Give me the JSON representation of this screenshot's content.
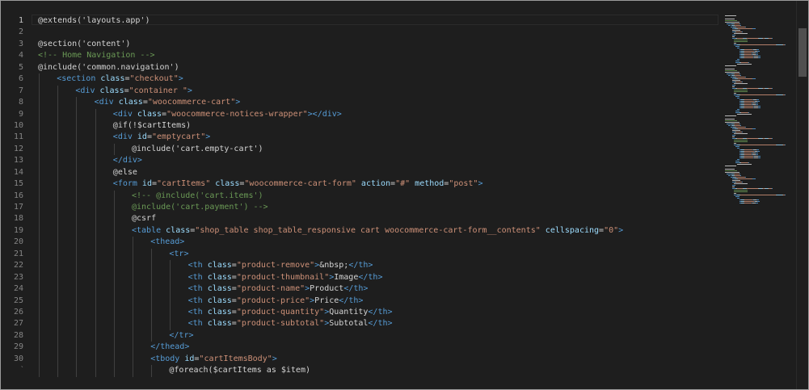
{
  "editor": {
    "active_line": "1",
    "line_numbers": [
      "1",
      "2",
      "3",
      "4",
      "5",
      "6",
      "7",
      "8",
      "9",
      "10",
      "11",
      "12",
      "13",
      "14",
      "15",
      "16",
      "17",
      "18",
      "19",
      "20",
      "21",
      "22",
      "23",
      "24",
      "25",
      "26",
      "27",
      "28",
      "29",
      "30",
      "ˋ"
    ],
    "colors": {
      "background": "#1e1e1e",
      "text": "#d4d4d4",
      "tag": "#569cd6",
      "attribute": "#9cdcfe",
      "string": "#ce9178",
      "comment": "#6a9955",
      "line_number": "#858585"
    },
    "lines": [
      {
        "indent": 0,
        "tokens": [
          {
            "t": "txt",
            "v": "@extends('layouts.app')"
          }
        ]
      },
      {
        "indent": 0,
        "tokens": []
      },
      {
        "indent": 0,
        "tokens": [
          {
            "t": "txt",
            "v": "@section('content')"
          }
        ]
      },
      {
        "indent": 0,
        "tokens": [
          {
            "t": "cmt",
            "v": "<!-- Home Navigation -->"
          }
        ]
      },
      {
        "indent": 0,
        "tokens": [
          {
            "t": "txt",
            "v": "@include('common.navigation')"
          }
        ]
      },
      {
        "indent": 1,
        "tokens": [
          {
            "t": "tag",
            "v": "<section "
          },
          {
            "t": "attr",
            "v": "class"
          },
          {
            "t": "txt",
            "v": "="
          },
          {
            "t": "str",
            "v": "\"checkout\""
          },
          {
            "t": "tag",
            "v": ">"
          }
        ]
      },
      {
        "indent": 2,
        "tokens": [
          {
            "t": "tag",
            "v": "<div "
          },
          {
            "t": "attr",
            "v": "class"
          },
          {
            "t": "txt",
            "v": "="
          },
          {
            "t": "str",
            "v": "\"container \""
          },
          {
            "t": "tag",
            "v": ">"
          }
        ]
      },
      {
        "indent": 3,
        "tokens": [
          {
            "t": "tag",
            "v": "<div "
          },
          {
            "t": "attr",
            "v": "class"
          },
          {
            "t": "txt",
            "v": "="
          },
          {
            "t": "str",
            "v": "\"woocommerce-cart\""
          },
          {
            "t": "tag",
            "v": ">"
          }
        ]
      },
      {
        "indent": 4,
        "tokens": [
          {
            "t": "tag",
            "v": "<div "
          },
          {
            "t": "attr",
            "v": "class"
          },
          {
            "t": "txt",
            "v": "="
          },
          {
            "t": "str",
            "v": "\"woocommerce-notices-wrapper\""
          },
          {
            "t": "tag",
            "v": "></div>"
          }
        ]
      },
      {
        "indent": 4,
        "tokens": [
          {
            "t": "txt",
            "v": "@if(!$cartItems)"
          }
        ]
      },
      {
        "indent": 4,
        "tokens": [
          {
            "t": "tag",
            "v": "<div "
          },
          {
            "t": "attr",
            "v": "id"
          },
          {
            "t": "txt",
            "v": "="
          },
          {
            "t": "str",
            "v": "\"emptycart\""
          },
          {
            "t": "tag",
            "v": ">"
          }
        ]
      },
      {
        "indent": 5,
        "tokens": [
          {
            "t": "txt",
            "v": "@include('cart.empty-cart')"
          }
        ]
      },
      {
        "indent": 4,
        "tokens": [
          {
            "t": "tag",
            "v": "</div>"
          }
        ]
      },
      {
        "indent": 4,
        "tokens": [
          {
            "t": "txt",
            "v": "@else"
          }
        ]
      },
      {
        "indent": 4,
        "tokens": [
          {
            "t": "tag",
            "v": "<form "
          },
          {
            "t": "attr",
            "v": "id"
          },
          {
            "t": "txt",
            "v": "="
          },
          {
            "t": "str",
            "v": "\"cartItems\""
          },
          {
            "t": "txt",
            "v": " "
          },
          {
            "t": "attr",
            "v": "class"
          },
          {
            "t": "txt",
            "v": "="
          },
          {
            "t": "str",
            "v": "\"woocommerce-cart-form\""
          },
          {
            "t": "txt",
            "v": " "
          },
          {
            "t": "attr",
            "v": "action"
          },
          {
            "t": "txt",
            "v": "="
          },
          {
            "t": "str",
            "v": "\"#\""
          },
          {
            "t": "txt",
            "v": " "
          },
          {
            "t": "attr",
            "v": "method"
          },
          {
            "t": "txt",
            "v": "="
          },
          {
            "t": "str",
            "v": "\"post\""
          },
          {
            "t": "tag",
            "v": ">"
          }
        ]
      },
      {
        "indent": 5,
        "tokens": [
          {
            "t": "cmt",
            "v": "<!-- @include('cart.items')"
          }
        ]
      },
      {
        "indent": 5,
        "tokens": [
          {
            "t": "cmt",
            "v": "@include('cart.payment') -->"
          }
        ]
      },
      {
        "indent": 5,
        "tokens": [
          {
            "t": "txt",
            "v": "@csrf"
          }
        ]
      },
      {
        "indent": 5,
        "tokens": [
          {
            "t": "tag",
            "v": "<table "
          },
          {
            "t": "attr",
            "v": "class"
          },
          {
            "t": "txt",
            "v": "="
          },
          {
            "t": "str",
            "v": "\"shop_table shop_table_responsive cart woocommerce-cart-form__contents\""
          },
          {
            "t": "txt",
            "v": " "
          },
          {
            "t": "attr",
            "v": "cellspacing"
          },
          {
            "t": "txt",
            "v": "="
          },
          {
            "t": "str",
            "v": "\"0\""
          },
          {
            "t": "tag",
            "v": ">"
          }
        ]
      },
      {
        "indent": 6,
        "tokens": [
          {
            "t": "tag",
            "v": "<thead>"
          }
        ]
      },
      {
        "indent": 7,
        "tokens": [
          {
            "t": "tag",
            "v": "<tr>"
          }
        ]
      },
      {
        "indent": 8,
        "tokens": [
          {
            "t": "tag",
            "v": "<th "
          },
          {
            "t": "attr",
            "v": "class"
          },
          {
            "t": "txt",
            "v": "="
          },
          {
            "t": "str",
            "v": "\"product-remove\""
          },
          {
            "t": "tag",
            "v": ">"
          },
          {
            "t": "ent",
            "v": "&nbsp;"
          },
          {
            "t": "tag",
            "v": "</th>"
          }
        ]
      },
      {
        "indent": 8,
        "tokens": [
          {
            "t": "tag",
            "v": "<th "
          },
          {
            "t": "attr",
            "v": "class"
          },
          {
            "t": "txt",
            "v": "="
          },
          {
            "t": "str",
            "v": "\"product-thumbnail\""
          },
          {
            "t": "tag",
            "v": ">"
          },
          {
            "t": "txt",
            "v": "Image"
          },
          {
            "t": "tag",
            "v": "</th>"
          }
        ]
      },
      {
        "indent": 8,
        "tokens": [
          {
            "t": "tag",
            "v": "<th "
          },
          {
            "t": "attr",
            "v": "class"
          },
          {
            "t": "txt",
            "v": "="
          },
          {
            "t": "str",
            "v": "\"product-name\""
          },
          {
            "t": "tag",
            "v": ">"
          },
          {
            "t": "txt",
            "v": "Product"
          },
          {
            "t": "tag",
            "v": "</th>"
          }
        ]
      },
      {
        "indent": 8,
        "tokens": [
          {
            "t": "tag",
            "v": "<th "
          },
          {
            "t": "attr",
            "v": "class"
          },
          {
            "t": "txt",
            "v": "="
          },
          {
            "t": "str",
            "v": "\"product-price\""
          },
          {
            "t": "tag",
            "v": ">"
          },
          {
            "t": "txt",
            "v": "Price"
          },
          {
            "t": "tag",
            "v": "</th>"
          }
        ]
      },
      {
        "indent": 8,
        "tokens": [
          {
            "t": "tag",
            "v": "<th "
          },
          {
            "t": "attr",
            "v": "class"
          },
          {
            "t": "txt",
            "v": "="
          },
          {
            "t": "str",
            "v": "\"product-quantity\""
          },
          {
            "t": "tag",
            "v": ">"
          },
          {
            "t": "txt",
            "v": "Quantity"
          },
          {
            "t": "tag",
            "v": "</th>"
          }
        ]
      },
      {
        "indent": 8,
        "tokens": [
          {
            "t": "tag",
            "v": "<th "
          },
          {
            "t": "attr",
            "v": "class"
          },
          {
            "t": "txt",
            "v": "="
          },
          {
            "t": "str",
            "v": "\"product-subtotal\""
          },
          {
            "t": "tag",
            "v": ">"
          },
          {
            "t": "txt",
            "v": "Subtotal"
          },
          {
            "t": "tag",
            "v": "</th>"
          }
        ]
      },
      {
        "indent": 7,
        "tokens": [
          {
            "t": "tag",
            "v": "</tr>"
          }
        ]
      },
      {
        "indent": 6,
        "tokens": [
          {
            "t": "tag",
            "v": "</thead>"
          }
        ]
      },
      {
        "indent": 6,
        "tokens": [
          {
            "t": "tag",
            "v": "<tbody "
          },
          {
            "t": "attr",
            "v": "id"
          },
          {
            "t": "txt",
            "v": "="
          },
          {
            "t": "str",
            "v": "\"cartItemsBody\""
          },
          {
            "t": "tag",
            "v": ">"
          }
        ]
      },
      {
        "indent": 7,
        "tokens": [
          {
            "t": "txt",
            "v": "@foreach($cartItems as $item)"
          }
        ]
      }
    ]
  }
}
